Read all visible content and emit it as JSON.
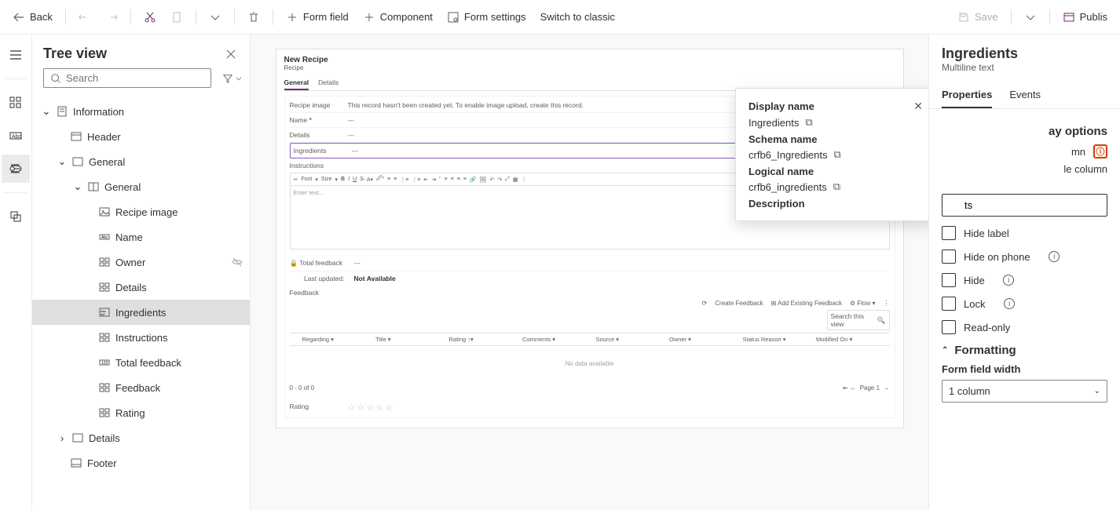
{
  "toolbar": {
    "back": "Back",
    "form_field": "Form field",
    "component": "Component",
    "form_settings": "Form settings",
    "switch_classic": "Switch to classic",
    "save": "Save",
    "publish": "Publis"
  },
  "tree": {
    "title": "Tree view",
    "search_placeholder": "Search",
    "items": {
      "information": "Information",
      "header": "Header",
      "general": "General",
      "general_section": "General",
      "recipe_image": "Recipe image",
      "name": "Name",
      "owner": "Owner",
      "details": "Details",
      "ingredients": "Ingredients",
      "instructions": "Instructions",
      "total_feedback": "Total feedback",
      "feedback": "Feedback",
      "rating": "Rating",
      "details_tab": "Details",
      "footer": "Footer"
    }
  },
  "canvas": {
    "title": "New Recipe",
    "subtitle": "Recipe",
    "tabs": {
      "general": "General",
      "details": "Details"
    },
    "fields": {
      "recipe_image": "Recipe image",
      "recipe_image_msg": "This record hasn't been created yet. To enable image upload, create this record.",
      "name": "Name",
      "details": "Details",
      "ingredients": "Ingredients",
      "instructions": "Instructions",
      "total_feedback": "Total feedback",
      "last_updated": "Last updated:",
      "not_available": "Not Available",
      "feedback": "Feedback"
    },
    "rte": {
      "font": "Font",
      "size": "Size",
      "placeholder": "Enter text..."
    },
    "grid": {
      "refresh": "",
      "create": "Create Feedback",
      "add_existing": "Add Existing Feedback",
      "flow": "Flow",
      "search": "Search this view",
      "cols": {
        "regarding": "Regarding",
        "title": "Title",
        "rating": "Rating",
        "comments": "Comments",
        "source": "Source",
        "owner": "Owner",
        "status_reason": "Status Reason",
        "modified_on": "Modified On"
      },
      "empty": "No data available",
      "range": "0 - 0 of 0",
      "page": "Page 1"
    },
    "rating_label": "Rating"
  },
  "popover": {
    "display_name_label": "Display name",
    "display_name": "Ingredients",
    "schema_name_label": "Schema name",
    "schema_name": "crfb6_Ingredients",
    "logical_name_label": "Logical name",
    "logical_name": "crfb6_ingredients",
    "description_label": "Description"
  },
  "right": {
    "title": "Ingredients",
    "subtitle": "Multiline text",
    "tabs": {
      "properties": "Properties",
      "events": "Events"
    },
    "display_options": "ay options",
    "table_column_frag": "mn",
    "table_column_line": "le column",
    "input_value": "ts",
    "hide_label": "Hide label",
    "hide_on_phone": "Hide on phone",
    "hide": "Hide",
    "lock": "Lock",
    "read_only": "Read-only",
    "formatting": "Formatting",
    "form_field_width": "Form field width",
    "form_field_width_value": "1 column"
  }
}
